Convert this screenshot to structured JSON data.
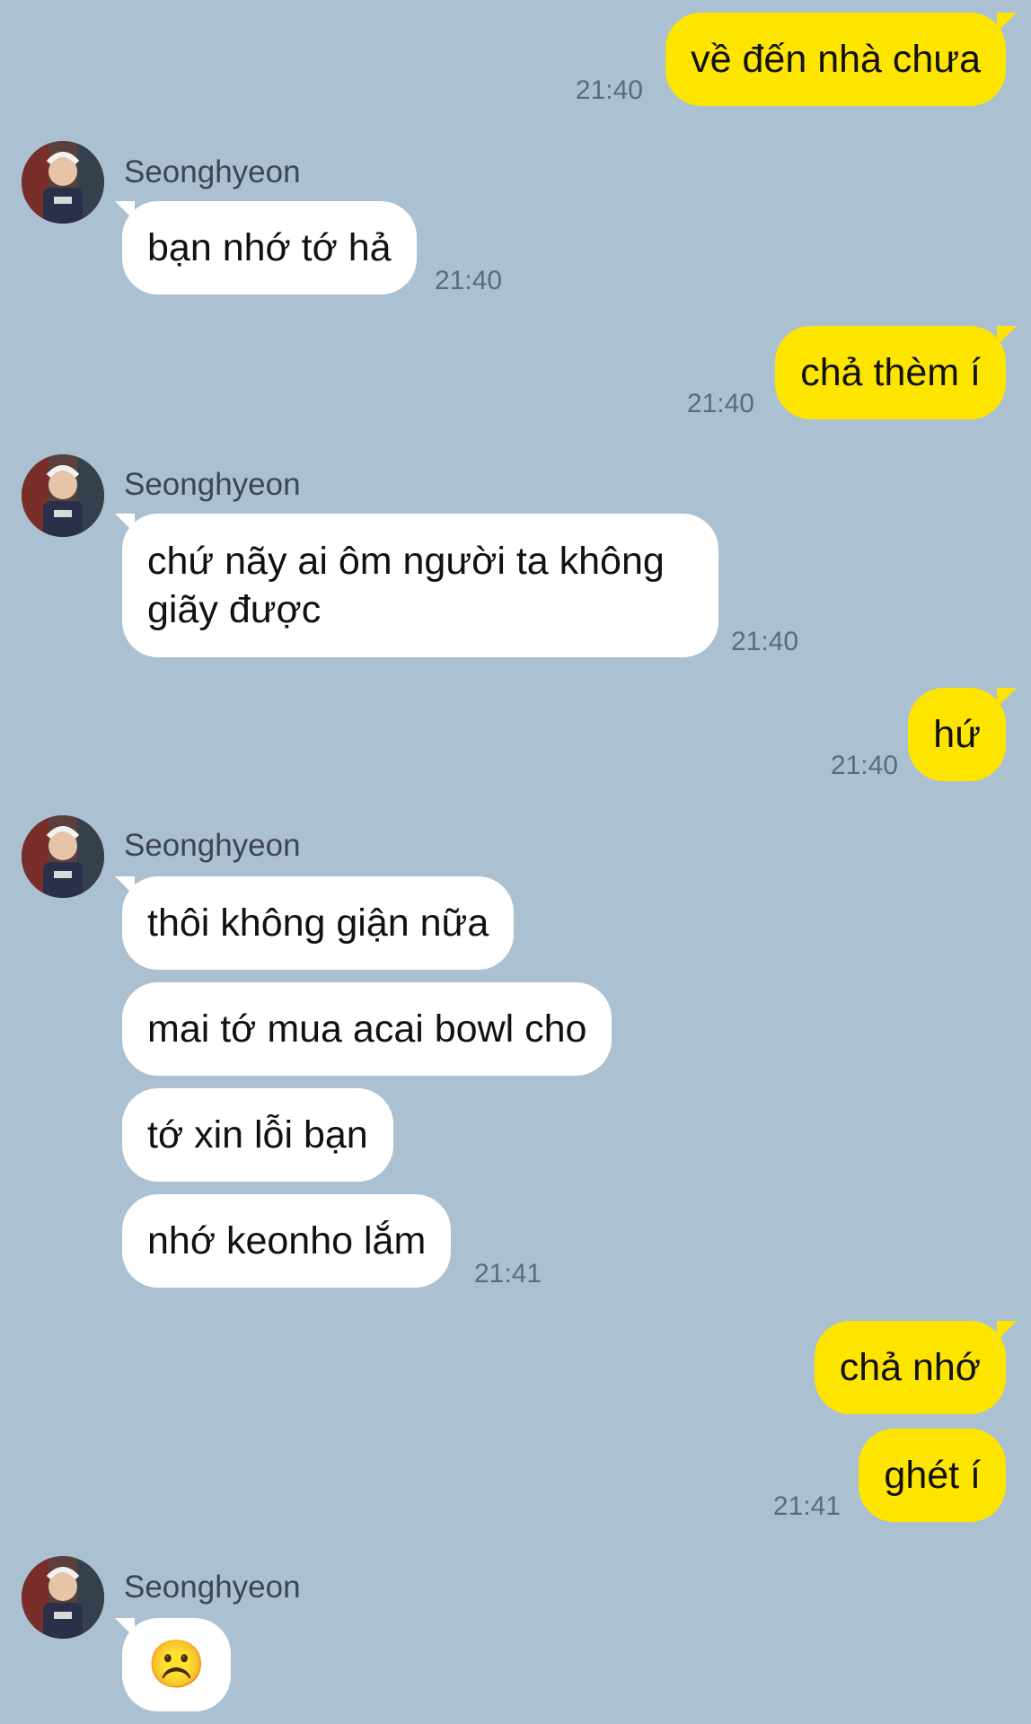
{
  "contact": {
    "name": "Seonghyeon"
  },
  "colors": {
    "background": "#abc1d1",
    "mine_bubble": "#fee500",
    "their_bubble": "#ffffff",
    "time_text": "#5d6b77"
  },
  "messages": [
    {
      "sender": "me",
      "text": "về đến nhà chưa",
      "time": "21:40"
    },
    {
      "sender": "them",
      "text": "bạn nhớ tớ hả",
      "time": "21:40"
    },
    {
      "sender": "me",
      "text": "chả thèm í",
      "time": "21:40"
    },
    {
      "sender": "them",
      "text": "chứ nãy ai ôm người ta không giãy được",
      "time": "21:40"
    },
    {
      "sender": "me",
      "text": "hứ",
      "time": "21:40"
    },
    {
      "sender": "them",
      "text": "thôi không giận nữa",
      "time": ""
    },
    {
      "sender": "them",
      "text": "mai tớ mua acai bowl cho",
      "time": ""
    },
    {
      "sender": "them",
      "text": "tớ xin lỗi bạn",
      "time": ""
    },
    {
      "sender": "them",
      "text": "nhớ keonho lắm",
      "time": "21:41"
    },
    {
      "sender": "me",
      "text": "chả nhớ",
      "time": ""
    },
    {
      "sender": "me",
      "text": "ghét í",
      "time": "21:41"
    },
    {
      "sender": "them",
      "text": "☹️",
      "time": ""
    }
  ]
}
